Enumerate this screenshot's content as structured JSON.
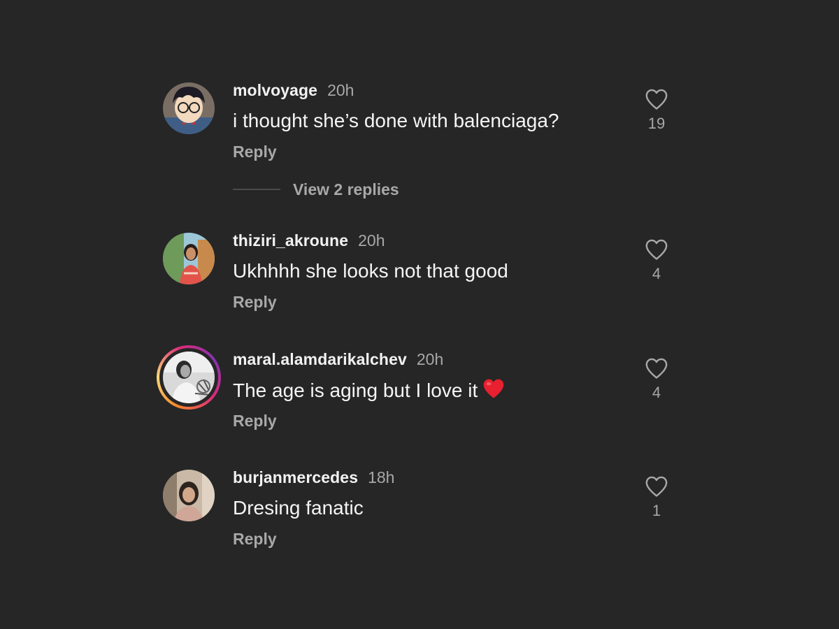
{
  "comments": [
    {
      "username": "molvoyage",
      "time": "20h",
      "text": "i thought she’s done with balenciaga?",
      "reply_label": "Reply",
      "likes": "19",
      "avatar_icon": "cartoon-boy-avatar",
      "has_story_ring": false
    },
    {
      "username": "thiziri_akroune",
      "time": "20h",
      "text": "Ukhhhh she looks not that good",
      "reply_label": "Reply",
      "likes": "4",
      "avatar_icon": "photo-avatar",
      "has_story_ring": false
    },
    {
      "username": "maral.alamdarikalchev",
      "time": "20h",
      "text": "The age is aging but I love it",
      "emoji": "red-heart-emoji",
      "reply_label": "Reply",
      "likes": "4",
      "avatar_icon": "photo-avatar",
      "has_story_ring": true
    },
    {
      "username": "burjanmercedes",
      "time": "18h",
      "text": "Dresing fanatic",
      "reply_label": "Reply",
      "likes": "1",
      "avatar_icon": "photo-avatar",
      "has_story_ring": false
    }
  ],
  "view_replies": {
    "label": "View 2 replies"
  },
  "colors": {
    "background": "#262626",
    "primary_text": "#f5f5f5",
    "secondary_text": "#a8a8a8",
    "heart_emoji": "#e8202f"
  },
  "icons": {
    "like": "heart-outline-icon"
  }
}
